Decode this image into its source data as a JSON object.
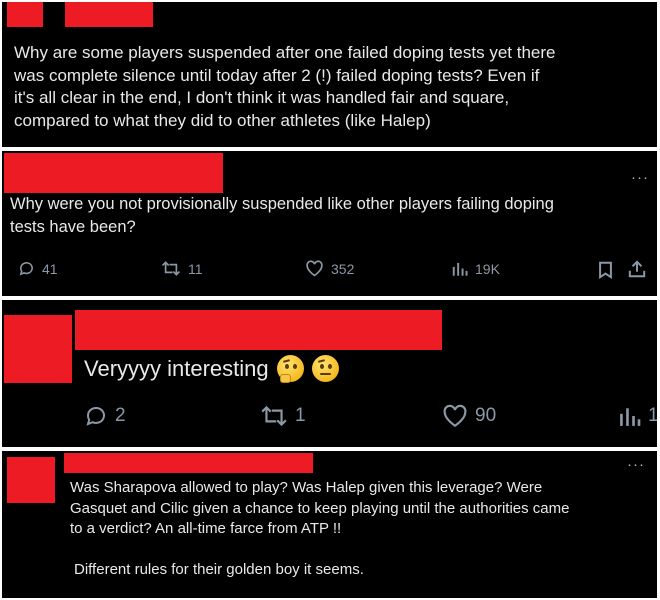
{
  "panels": [
    {
      "text_lines": [
        "Why are some players suspended after one failed doping tests yet there",
        "was complete silence until today after 2 (!) failed doping tests? Even if",
        "it's all clear in the end, I don't think it was handled fair and square,",
        "compared to what they did to other athletes (like Halep)"
      ]
    },
    {
      "more": "···",
      "text_lines": [
        "Why were you not provisionally suspended like other players failing doping",
        "tests have been?"
      ],
      "actions": {
        "replies": "41",
        "reposts": "11",
        "likes": "352",
        "views": "19K"
      }
    },
    {
      "text": "Veryyyy interesting",
      "emojis": [
        "thinking-face-emoji",
        "face-with-raised-eyebrow-emoji"
      ],
      "actions": {
        "replies": "2",
        "reposts": "1",
        "likes": "90",
        "views": "1"
      }
    },
    {
      "more": "···",
      "text_lines": [
        "Was Sharapova allowed to play? Was Halep given this leverage? Were",
        "Gasquet and Cilic given a chance to keep playing until the authorities came",
        "to a verdict?  An all-time farce from ATP !!",
        "",
        "Different rules for their golden boy it seems."
      ]
    }
  ],
  "colors": {
    "redaction": "#ed1c24",
    "background": "#000000",
    "text": "#e7e9ea",
    "icon": "#8b98a5"
  }
}
